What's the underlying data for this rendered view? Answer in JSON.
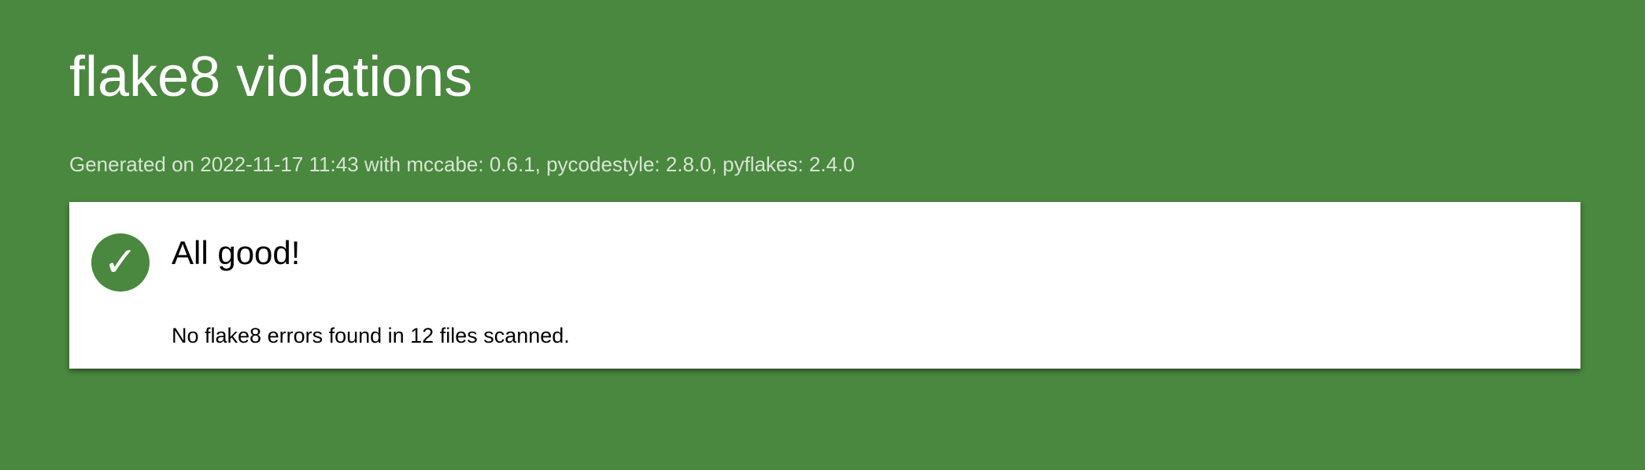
{
  "page": {
    "title": "flake8 violations",
    "generated_info": "Generated on 2022-11-17 11:43 with mccabe: 0.6.1, pycodestyle: 2.8.0, pyflakes: 2.4.0"
  },
  "result_card": {
    "icon": "check-icon",
    "icon_glyph": "✓",
    "heading": "All good!",
    "message": "No flake8 errors found in 12 files scanned."
  },
  "colors": {
    "background": "#4a873f",
    "card": "#ffffff",
    "accent": "#4a873f"
  }
}
